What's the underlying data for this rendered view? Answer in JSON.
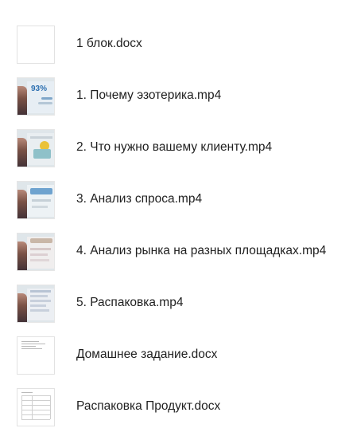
{
  "files": [
    {
      "name": "1 блок.docx",
      "kind": "docx-blank",
      "icon": "docx-file-icon"
    },
    {
      "name": "1. Почему эзотерика.mp4",
      "kind": "video",
      "icon": "video-thumbnail",
      "badge_text": "93%"
    },
    {
      "name": "2. Что нужно вашему клиенту.mp4",
      "kind": "video",
      "icon": "video-thumbnail"
    },
    {
      "name": "3. Анализ спроса.mp4",
      "kind": "video",
      "icon": "video-thumbnail"
    },
    {
      "name": "4. Анализ рынка на разных площадках.mp4",
      "kind": "video",
      "icon": "video-thumbnail"
    },
    {
      "name": "5. Распаковка.mp4",
      "kind": "video",
      "icon": "video-thumbnail"
    },
    {
      "name": "Домашнее задание.docx",
      "kind": "docx-text",
      "icon": "docx-file-icon"
    },
    {
      "name": "Распаковка Продукт.docx",
      "kind": "docx-table",
      "icon": "docx-file-icon"
    }
  ],
  "colors": {
    "text": "#1f1f1f",
    "thumb_border": "#e2e2e2",
    "slide_bg": "#eef3f6",
    "accent_blue": "#2c6fb0",
    "accent_yellow": "#e9c23a"
  }
}
